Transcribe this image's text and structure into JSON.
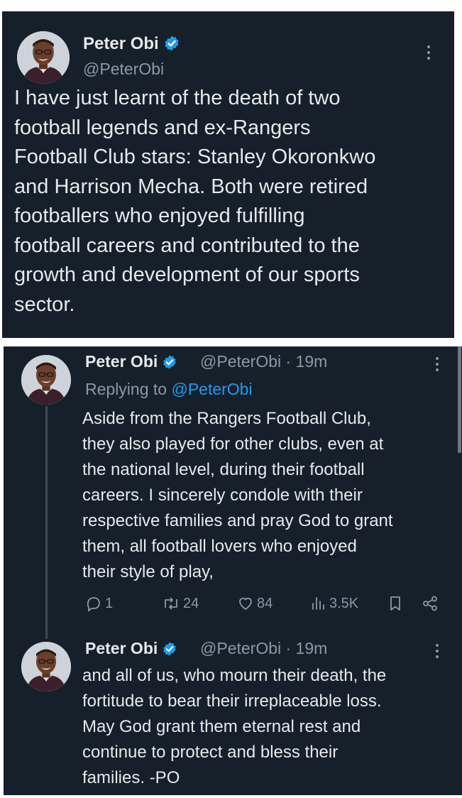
{
  "tweet1": {
    "name": "Peter Obi",
    "handle": "@PeterObi",
    "text": "I have just learnt of the death of two\nfootball legends and ex-Rangers\nFootball Club stars: Stanley Okoronkwo\nand Harrison Mecha. Both were retired\nfootballers who enjoyed fulfilling\nfootball careers and contributed to the\ngrowth and development of our sports\nsector."
  },
  "tweet2": {
    "name": "Peter Obi",
    "handle_time": "@PeterObi · 19m",
    "replying_prefix": "Replying to ",
    "replying_handle": "@PeterObi",
    "text": "Aside from the Rangers Football Club,\nthey also played for other clubs, even at\nthe national level, during their football\ncareers. I sincerely condole with their\nrespective families and pray God to grant\nthem, all football lovers who enjoyed\ntheir style of play,",
    "stats": {
      "replies": "1",
      "reposts": "24",
      "likes": "84",
      "views": "3.5K"
    }
  },
  "tweet3": {
    "name": "Peter Obi",
    "handle_time": "@PeterObi · 19m",
    "text": "and all of us, who mourn their death, the\nfortitude to bear their irreplaceable loss.\nMay God grant them eternal rest and\ncontinue to protect and bless their\nfamilies. -PO"
  },
  "icons": {
    "verified": "verified-badge-icon",
    "more": "more-options-icon",
    "reply": "reply-icon",
    "repost": "repost-icon",
    "like": "heart-icon",
    "views": "views-icon",
    "bookmark": "bookmark-icon",
    "share": "share-icon"
  },
  "colors": {
    "background": "#15202b",
    "text": "#e7e9ea",
    "secondary": "#8b98a5",
    "accent": "#1d9bf0"
  }
}
